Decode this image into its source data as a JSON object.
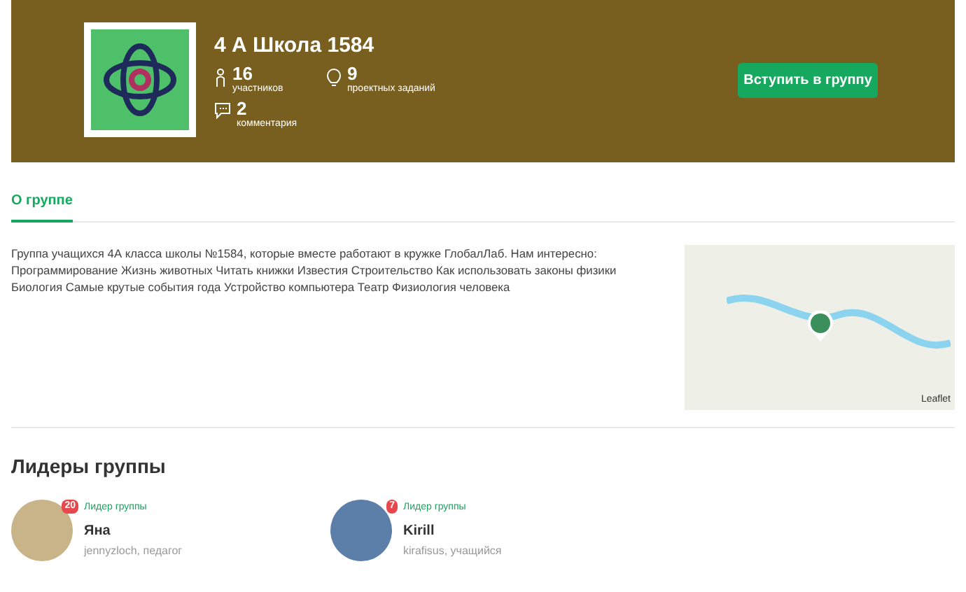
{
  "group": {
    "title": "4 А Школа 1584",
    "stats": [
      {
        "kind": "members",
        "value": "16",
        "label": "участников"
      },
      {
        "kind": "projects",
        "value": "9",
        "label": "проектных заданий"
      },
      {
        "kind": "comments",
        "value": "2",
        "label": "комментария"
      }
    ],
    "join_button": "Вступить в группу"
  },
  "tabs": [
    {
      "label": "О группе",
      "selected": true
    }
  ],
  "description": "Группа учащихся 4А класса школы №1584, которые вместе работают в кружке ГлобалЛаб. Нам интересно: Программирование Жизнь животных Читать книжки Известия Строительство Как использовать законы физики Биология Самые крутые события года Устройство компьютера Театр Физиология человека",
  "map": {
    "attribution": "Leaflet"
  },
  "leaders": {
    "title": "Лидеры группы",
    "items": [
      {
        "role": "Лидер группы",
        "name": "Яна",
        "subtitle": "jennyzloch, педагог",
        "badge": "20"
      },
      {
        "role": "Лидер группы",
        "name": "Kirill",
        "subtitle": "kirafisus, учащийся",
        "badge": "7"
      }
    ]
  }
}
